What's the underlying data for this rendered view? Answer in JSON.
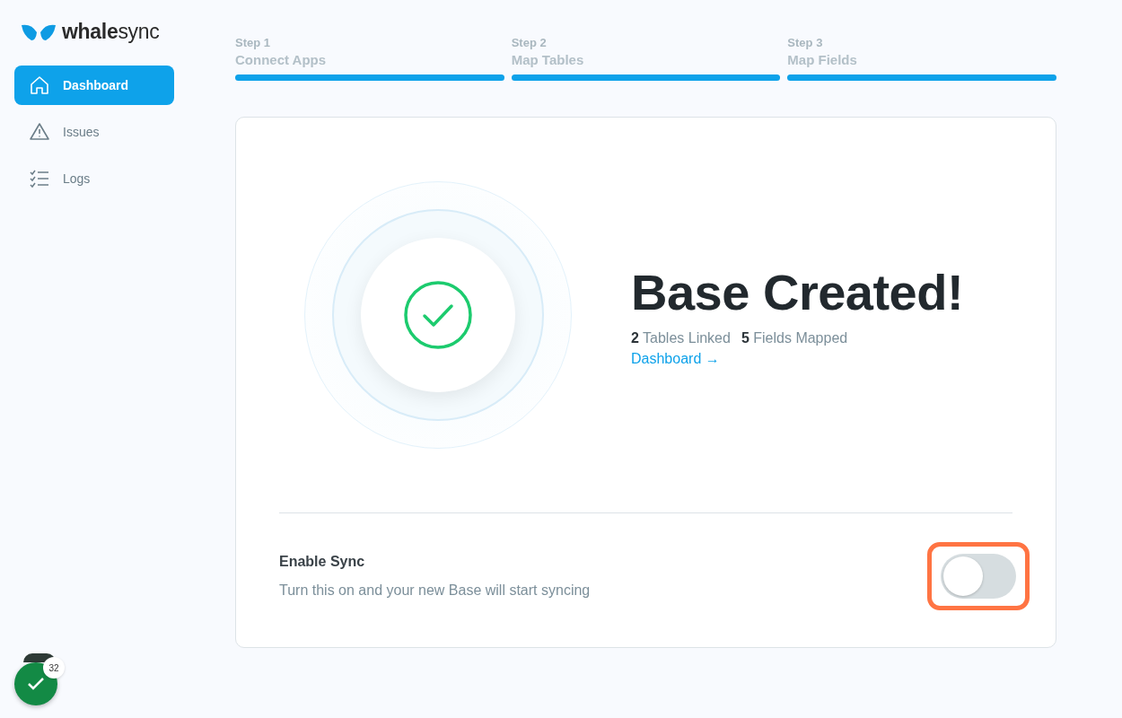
{
  "logo": {
    "text_bold": "whale",
    "text_light": "sync"
  },
  "sidebar": {
    "items": [
      {
        "label": "Dashboard",
        "selected": true
      },
      {
        "label": "Issues",
        "selected": false
      },
      {
        "label": "Logs",
        "selected": false
      }
    ]
  },
  "steps": [
    {
      "step": "Step 1",
      "label": "Connect Apps",
      "level": 1
    },
    {
      "step": "Step 2",
      "label": "Map Tables",
      "level": 1
    },
    {
      "step": "Step 3",
      "label": "Map Fields",
      "level": 1
    }
  ],
  "result": {
    "title": "Base Created!",
    "stats": [
      "**2** Tables Linked",
      "**5** Fields Mapped"
    ],
    "link": "Dashboard →"
  },
  "sync": {
    "title": "Enable Sync",
    "description": "Turn this on and your new Base will start syncing",
    "on": false,
    "highlighted": true
  },
  "user": {
    "badge": "32"
  }
}
